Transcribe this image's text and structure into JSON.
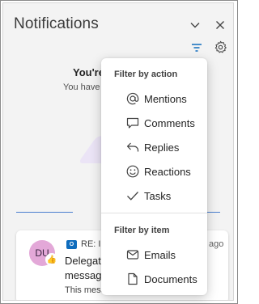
{
  "header": {
    "title": "Notifications"
  },
  "empty_state": {
    "title": "You're",
    "subtitle": "You have"
  },
  "notification": {
    "avatar_initials": "DU",
    "reaction": "👍",
    "subject": "RE: IF",
    "age": "ago",
    "line1": "Delegate",
    "line2": "message",
    "line3": "This mess"
  },
  "filter_menu": {
    "action_heading": "Filter by action",
    "actions": [
      {
        "label": "Mentions",
        "icon": "at-sign-icon"
      },
      {
        "label": "Comments",
        "icon": "comment-icon"
      },
      {
        "label": "Replies",
        "icon": "reply-icon"
      },
      {
        "label": "Reactions",
        "icon": "smile-icon"
      },
      {
        "label": "Tasks",
        "icon": "checkmark-icon"
      }
    ],
    "item_heading": "Filter by item",
    "items": [
      {
        "label": "Emails",
        "icon": "mail-icon"
      },
      {
        "label": "Documents",
        "icon": "document-icon"
      }
    ]
  },
  "colors": {
    "accent": "#0f6cbd",
    "avatar": "#e3a8d8",
    "pane_bg": "#f3f3f3"
  }
}
